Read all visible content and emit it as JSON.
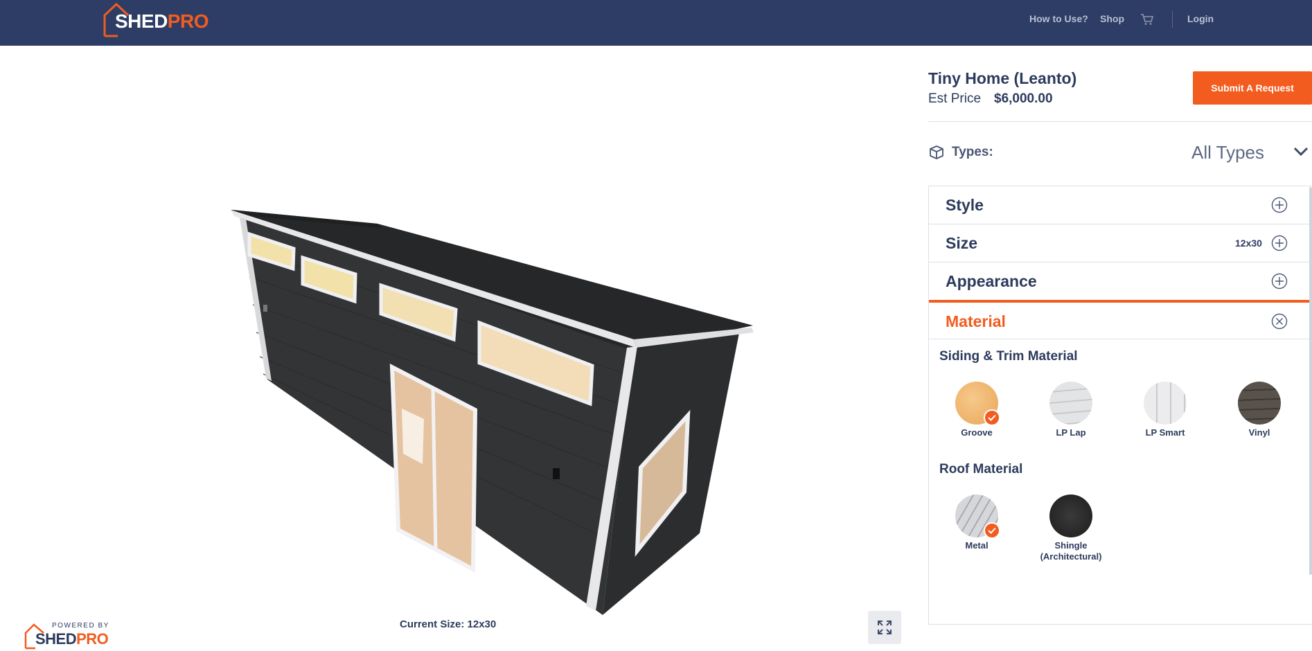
{
  "brand": {
    "logo_white": "SHED",
    "logo_orange": "PRO",
    "powered_by": "POWERED BY"
  },
  "nav": {
    "how_to": "How to Use?",
    "shop": "Shop",
    "cart_icon": "cart-icon",
    "login": "Login"
  },
  "viewer": {
    "current_size": "Current Size: 12x30",
    "fullscreen_icon": "expand-icon"
  },
  "product": {
    "title": "Tiny Home (Leanto)",
    "est_label": "Est Price",
    "est_value": "$6,000.00",
    "submit": "Submit A Request"
  },
  "types": {
    "label": "Types:",
    "value": "All Types"
  },
  "accordion": [
    {
      "label": "Style",
      "value": "",
      "state": "collapsed"
    },
    {
      "label": "Size",
      "value": "12x30",
      "state": "collapsed"
    },
    {
      "label": "Appearance",
      "value": "",
      "state": "collapsed"
    },
    {
      "label": "Material",
      "value": "",
      "state": "expanded"
    }
  ],
  "material": {
    "siding_title": "Siding & Trim Material",
    "siding": [
      {
        "name": "Groove",
        "selected": true,
        "color": "#f0b46a"
      },
      {
        "name": "LP Lap",
        "selected": false,
        "color": "#d9dadc"
      },
      {
        "name": "LP Smart",
        "selected": false,
        "color": "#e6e7e9"
      },
      {
        "name": "Vinyl",
        "selected": false,
        "color": "#4e4943"
      }
    ],
    "roof_title": "Roof Material",
    "roof": [
      {
        "name": "Metal",
        "selected": true,
        "color": "#c9cbcf"
      },
      {
        "name": "Shingle (Architectural)",
        "selected": false,
        "color": "#2b2b2b"
      }
    ]
  },
  "colors": {
    "header_bg": "#2e3d66",
    "accent": "#f25c1f",
    "text_dark": "#2c3a5c"
  }
}
